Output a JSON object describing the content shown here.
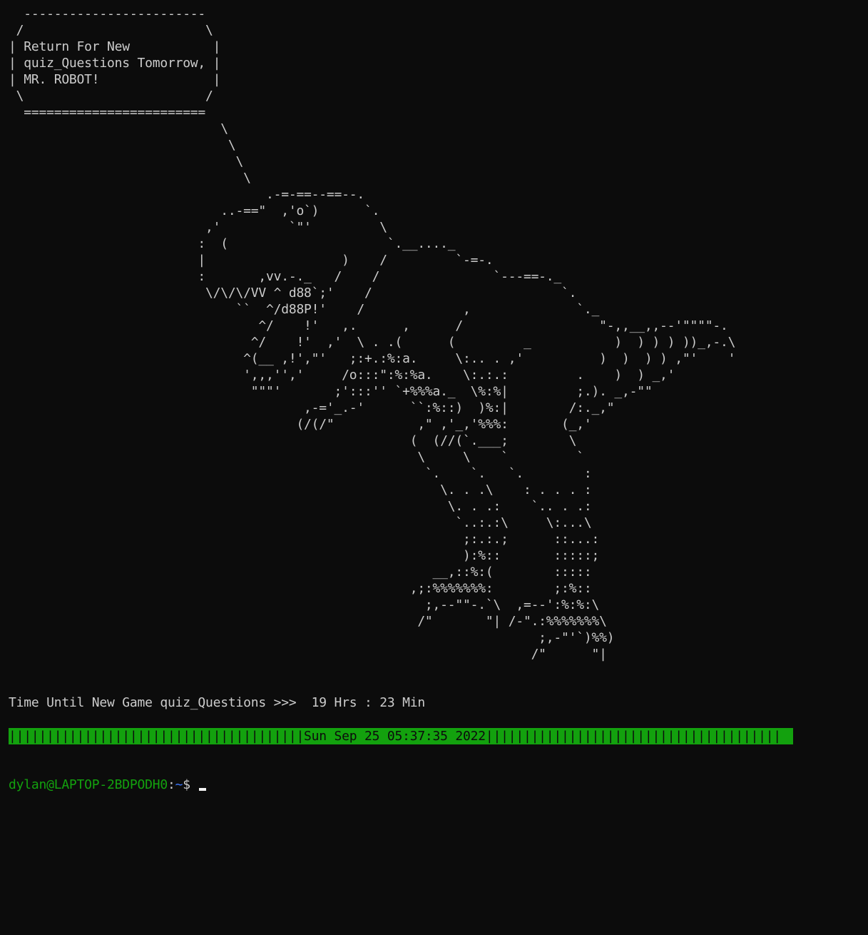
{
  "ascii_art": "  ------------------------\n /                        \\\n| Return For New           |\n| quiz_Questions Tomorrow, |\n| MR. ROBOT!               |\n \\                        /\n  ========================\n                            \\\n                             \\\n                              \\\n                               \\\n                                  .-=-==--==--.\n                            ..-==\"  ,'o`)      `.\n                          ,'         `\"'         \\\n                         :  (                     `.__...._\n                         |                  )    /         `-=-.\n                         :       ,vv.-._   /    /               `---==-._\n                          \\/\\/\\/VV ^ d88`;'    /                         `.\n                              ``  ^/d88P!'    /             ,              `._\n                                 ^/    !'   ,.      ,      /                  \"-,,__,,--'\"\"\"\"-.\n                                ^/    !'  ,'  \\ . .(      (         _           )  ) ) ) ))_,-.\\\n                               ^(__ ,!',\"'   ;:+.:%:a.     \\:.. . ,'          )  )  ) ) ,\"'    '\n                               ',,,'','     /o:::\":%:%a.    \\:.:.:         .    )  ) _,'\n                                \"\"\"'       ;':::'' `+%%%a._  \\%:%|         ;.). _,-\"\"\n                                       ,-='_.-'      ``:%::)  )%:|        /:._,\"\n                                      (/(/\"           ,\" ,'_,'%%%:       (_,'\n                                                     (  (//(`.___;        \\\n                                                      \\     \\    `         `\n                                                       `.    `.   `.        :\n                                                         \\. . .\\    : . . . :\n                                                          \\. . .:    `.. . .:\n                                                           `..:.:\\     \\:...\\\n                                                            ;:.:.;      ::...:\n                                                            ):%::       :::::;\n                                                        __,::%:(        :::::\n                                                     ,;:%%%%%%%:        ;:%::\n                                                       ;,--\"\"-.`\\  ,=--':%:%:\\\n                                                      /\"       \"| /-\".:%%%%%%%\\\n                                                                      ;,-\"'`)%%)\n                                                                     /\"      \"|",
  "countdown": {
    "text": "Time Until New Game quiz_Questions >>>  19 Hrs : 23 Min"
  },
  "progress_bar": {
    "text": "|||||||||||||||||||||||||||||||||||||||Sun Sep 25 05:37:35 2022|||||||||||||||||||||||||||||||||||||||",
    "color": "#13a10e"
  },
  "prompt": {
    "user_host": "dylan@LAPTOP-2BDPODH0",
    "separator": ":",
    "path": "~",
    "symbol": "$ "
  }
}
